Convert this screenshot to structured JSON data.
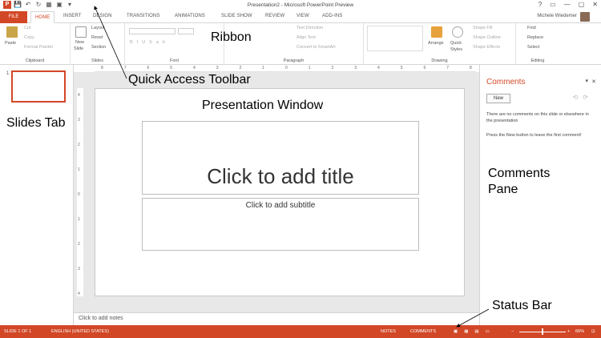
{
  "app": {
    "title": "Presentation2 - Microsoft PowerPoint Preview",
    "user": "Michele Wiedemer",
    "window_buttons": [
      "?",
      "▭",
      "—",
      "▢",
      "✕"
    ]
  },
  "quick_access": [
    "P",
    "💾",
    "↶",
    "↻",
    "▦",
    "▣",
    "▾"
  ],
  "tabs": [
    {
      "label": "FILE"
    },
    {
      "label": "HOME"
    },
    {
      "label": "INSERT"
    },
    {
      "label": "DESIGN"
    },
    {
      "label": "TRANSITIONS"
    },
    {
      "label": "ANIMATIONS"
    },
    {
      "label": "SLIDE SHOW"
    },
    {
      "label": "REVIEW"
    },
    {
      "label": "VIEW"
    },
    {
      "label": "ADD-INS"
    }
  ],
  "ribbon": {
    "clipboard": {
      "label": "Clipboard",
      "paste": "Paste",
      "cut": "Cut",
      "copy": "Copy",
      "format_painter": "Format Painter"
    },
    "slides": {
      "label": "Slides",
      "new_slide": "New",
      "new_slide2": "Slide",
      "layout": "Layout",
      "reset": "Reset",
      "section": "Section"
    },
    "font": {
      "label": "Font"
    },
    "paragraph": {
      "label": "Paragraph",
      "text_direction": "Text Direction",
      "align_text": "Align Text",
      "smartart": "Convert to SmartArt"
    },
    "drawing": {
      "label": "Drawing",
      "arrange": "Arrange",
      "quick_styles": "Quick",
      "quick_styles2": "Styles",
      "shape_fill": "Shape Fill",
      "shape_outline": "Shape Outline",
      "shape_effects": "Shape Effects"
    },
    "editing": {
      "label": "Editing",
      "find": "Find",
      "replace": "Replace",
      "select": "Select"
    }
  },
  "ruler_marks": [
    "8",
    "7",
    "6",
    "5",
    "4",
    "3",
    "2",
    "1",
    "0",
    "1",
    "2",
    "3",
    "4",
    "5",
    "6",
    "7",
    "8"
  ],
  "vruler_marks": [
    "4",
    "3",
    "2",
    "1",
    "0",
    "1",
    "2",
    "3",
    "4"
  ],
  "slides_panel": {
    "thumb_number": "1"
  },
  "slide": {
    "title_placeholder": "Click to add title",
    "subtitle_placeholder": "Click to add subtitle"
  },
  "notes": "Click to add notes",
  "comments": {
    "title": "Comments",
    "new_button": "New",
    "empty_message": "There are no comments on this slide or elsewhere in the presentation",
    "hint": "Press the New button to leave the first comment!"
  },
  "status": {
    "slide": "SLIDE 1 OF 1",
    "language": "ENGLISH (UNITED STATES)",
    "notes": "NOTES",
    "comments": "COMMENTS",
    "zoom": "66%"
  },
  "annotations": {
    "ribbon": "Ribbon",
    "qat": "Quick Access Toolbar",
    "slides_tab": "Slides Tab",
    "presentation_window": "Presentation Window",
    "comments_pane_1": "Comments",
    "comments_pane_2": "Pane",
    "status_bar": "Status Bar"
  },
  "colors": {
    "accent": "#d24726"
  }
}
